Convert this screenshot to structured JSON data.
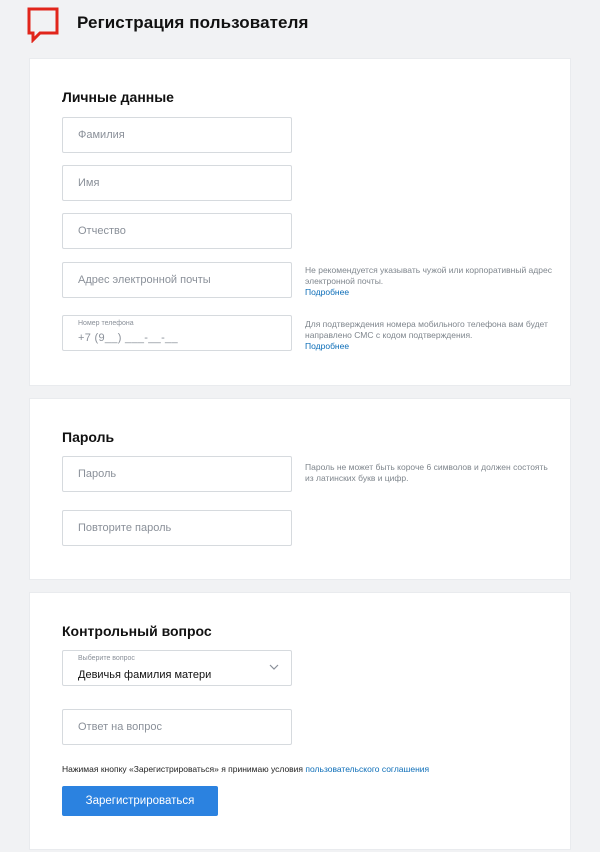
{
  "header": {
    "title": "Регистрация пользователя",
    "logo_icon": "speech-bubble-logo-icon",
    "brand_color": "#e1251b"
  },
  "personal": {
    "title": "Личные данные",
    "last_name_placeholder": "Фамилия",
    "first_name_placeholder": "Имя",
    "middle_name_placeholder": "Отчество",
    "email_placeholder": "Адрес электронной почты",
    "email_hint": "Не рекомендуется указывать чужой или корпоративный адрес электронной почты.",
    "email_hint_link": "Подробнее",
    "phone_label": "Номер телефона",
    "phone_mask": "+7 (9__) ___-__-__",
    "phone_hint": "Для подтверждения номера мобильного телефона вам будет направлено СМС с кодом подтверждения.",
    "phone_hint_link": "Подробнее"
  },
  "password": {
    "title": "Пароль",
    "password_placeholder": "Пароль",
    "repeat_placeholder": "Повторите пароль",
    "hint": "Пароль не может быть короче 6 символов и должен состоять из латинских букв и цифр."
  },
  "question": {
    "title": "Контрольный вопрос",
    "select_label": "Выберите вопрос",
    "select_value": "Девичья фамилия матери",
    "answer_placeholder": "Ответ на вопрос",
    "agreement_text": "Нажимая кнопку «Зарегистрироваться» я принимаю условия",
    "agreement_link": "пользовательского соглашения",
    "submit_label": "Зарегистрироваться",
    "accent_color": "#2b82e0",
    "link_color": "#0d6eb8"
  }
}
